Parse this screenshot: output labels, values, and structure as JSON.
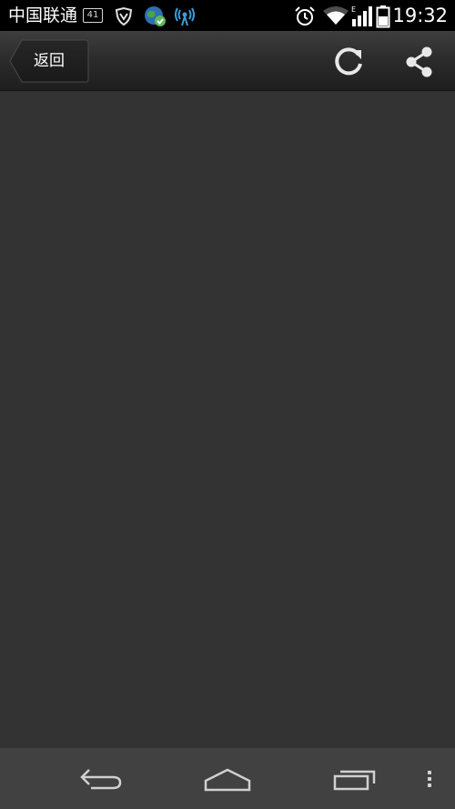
{
  "status_bar": {
    "carrier": "中国联通",
    "notification_badge": "41",
    "time": "19:32",
    "icons": [
      "notification-count-icon",
      "shield-icon",
      "globe-app-icon",
      "hotspot-icon",
      "alarm-icon",
      "wifi-icon",
      "signal-icon",
      "battery-icon"
    ]
  },
  "action_bar": {
    "back_label": "返回",
    "icons": [
      "refresh-icon",
      "share-icon"
    ]
  },
  "nav_bar": {
    "icons": [
      "back-nav-icon",
      "home-nav-icon",
      "recent-apps-icon",
      "more-options-icon"
    ]
  }
}
